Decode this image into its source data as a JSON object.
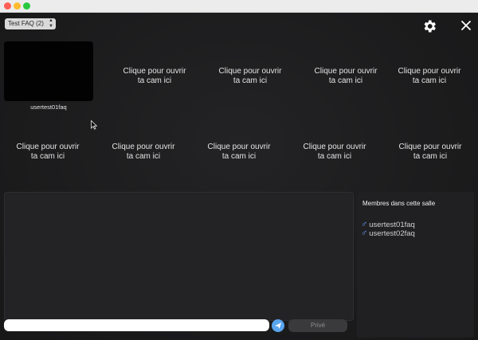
{
  "window": {
    "controls": [
      "close",
      "minimize",
      "maximize"
    ]
  },
  "toolbar": {
    "room_select_value": "Test FAQ (2)",
    "settings_icon": "gear-icon",
    "close_icon": "close-icon"
  },
  "cams": {
    "self_name": "usertest01faq",
    "slots": [
      {
        "line1": "Clique pour ouvrir",
        "line2": "ta cam ici"
      },
      {
        "line1": "Clique pour ouvrir",
        "line2": "ta cam ici"
      },
      {
        "line1": "Clique pour ouvrir",
        "line2": "ta cam ici"
      },
      {
        "line1": "Clique pour ouvrir",
        "line2": "ta cam ici"
      },
      {
        "line1": "Clique pour ouvrir",
        "line2": "ta cam ici"
      },
      {
        "line1": "Clique pour ouvrir",
        "line2": "ta cam ici"
      },
      {
        "line1": "Clique pour ouvrir",
        "line2": "ta cam ici"
      },
      {
        "line1": "Clique pour ouvrir",
        "line2": "ta cam ici"
      },
      {
        "line1": "Clique pour ouvrir",
        "line2": "ta cam ici"
      }
    ]
  },
  "members": {
    "title": "Membres dans cette salle",
    "list": [
      {
        "gender_icon": "male-icon",
        "name": "usertest01faq"
      },
      {
        "gender_icon": "male-icon",
        "name": "usertest02faq"
      }
    ]
  },
  "chat": {
    "input_value": "",
    "input_placeholder": "",
    "send_icon": "send-icon",
    "private_label": "Privé"
  },
  "colors": {
    "background": "#1b1b1d",
    "accent": "#5aa5f0",
    "male": "#6aa0ff"
  }
}
